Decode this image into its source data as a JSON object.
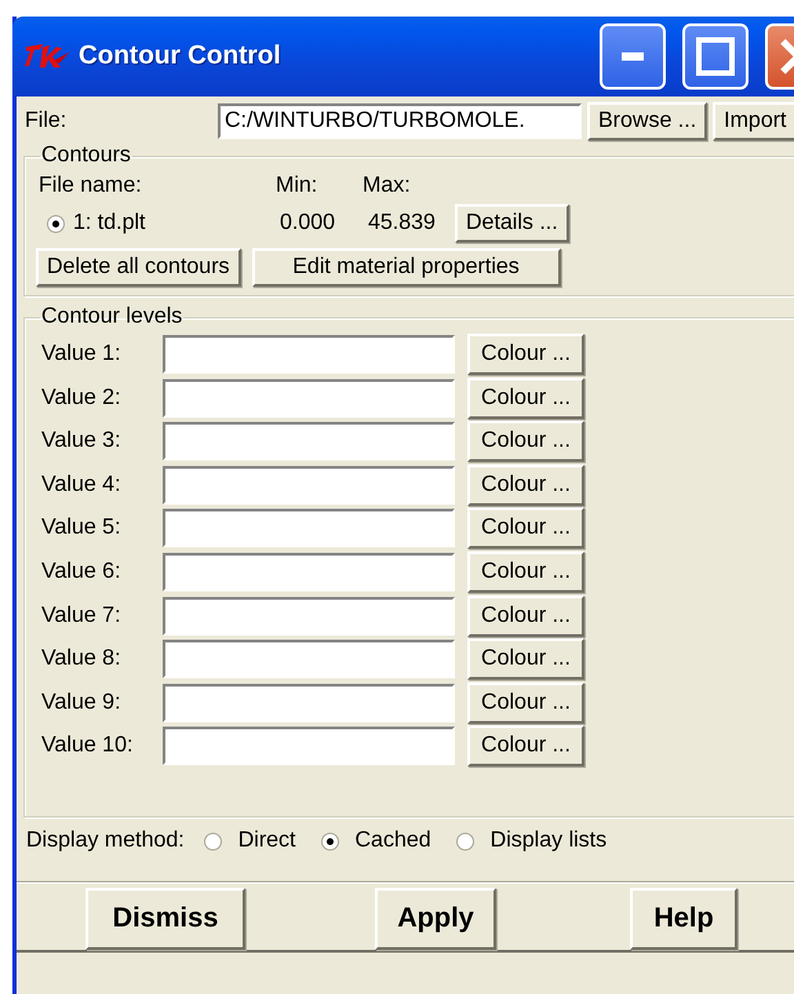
{
  "window": {
    "title": "Contour Control"
  },
  "file": {
    "label": "File:",
    "value": "C:/WINTURBO/TURBOMOLE.",
    "buttons": [
      "Browse ...",
      "Import"
    ]
  },
  "contours": {
    "title": "Contours",
    "headers": [
      "File name:",
      "Min:",
      "Max:"
    ],
    "items": [
      {
        "name": "1: td.plt",
        "selected": true,
        "min": "0.000",
        "max": "45.839",
        "button": "Details ..."
      }
    ],
    "buttons": [
      "Delete all contours",
      "Edit material properties"
    ]
  },
  "contour_levels": {
    "title": "Contour levels",
    "rows": [
      {
        "label": "Value 1:",
        "button": "Colour ..."
      },
      {
        "label": "Value 2:",
        "button": "Colour ..."
      },
      {
        "label": "Value 3:",
        "button": "Colour ..."
      },
      {
        "label": "Value 4:",
        "button": "Colour ..."
      },
      {
        "label": "Value 5:",
        "button": "Colour ..."
      },
      {
        "label": "Value 6:",
        "button": "Colour ..."
      },
      {
        "label": "Value 7:",
        "button": "Colour ..."
      },
      {
        "label": "Value 8:",
        "button": "Colour ..."
      },
      {
        "label": "Value 9:",
        "button": "Colour ..."
      },
      {
        "label": "Value 10:",
        "button": "Colour ..."
      }
    ]
  },
  "display_method": {
    "label": "Display method:",
    "options": [
      {
        "label": "Direct",
        "selected": false
      },
      {
        "label": "Cached",
        "selected": true
      },
      {
        "label": "Display lists",
        "selected": false
      }
    ]
  },
  "buttons": [
    "Dismiss",
    "Apply",
    "Help"
  ]
}
